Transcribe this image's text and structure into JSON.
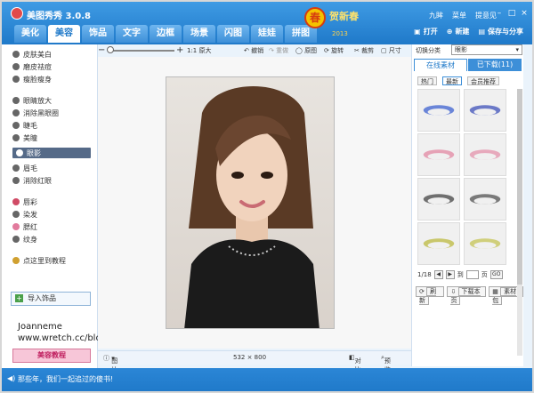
{
  "app": {
    "title": "美图秀秀 3.0.8"
  },
  "tabs": [
    "美化",
    "美容",
    "饰品",
    "文字",
    "边框",
    "场景",
    "闪图",
    "娃娃",
    "拼图"
  ],
  "header": {
    "new_year_text": "贺新春",
    "year": "2013",
    "badge": "春",
    "user": "九眸",
    "menu": "菜单",
    "feedback": "提意见",
    "actions": [
      "打开",
      "新建",
      "保存与分享"
    ]
  },
  "sidebar": {
    "items": [
      "皮肤美白",
      "磨皮祛痘",
      "瘦脸瘦身",
      "眼睛放大",
      "消除黑眼圈",
      "睫毛",
      "美瞳",
      "眼影",
      "眉毛",
      "消除红眼",
      "唇彩",
      "染发",
      "腮红",
      "纹身",
      "点这里到教程"
    ],
    "active_index": 7,
    "import_label": "导入饰品",
    "beauty_tutorial": "美容教程"
  },
  "watermark": {
    "name": "Joanneme",
    "url": "www.wretch.cc/blog/joanneme"
  },
  "toolbar": {
    "zoom_label": "1:1 原大",
    "undo": "撤销",
    "redo": "重做",
    "original": "原图",
    "rotate": "旋转",
    "crop": "裁剪",
    "size": "尺寸"
  },
  "status": {
    "image_info": "图片信息",
    "dimensions": "532 × 800",
    "compare": "对比",
    "preview": "预览"
  },
  "right_panel": {
    "switch_label": "切换分类",
    "category": "眼影",
    "tab_online": "在线素材",
    "tab_downloaded": "已下载(11)",
    "sub_tabs": [
      "热门",
      "最新",
      "会员推荐"
    ],
    "page": "1/18",
    "goto": "到",
    "page_unit": "页",
    "go": "GO",
    "refresh": "刷新",
    "download_page": "下载本页",
    "material_pack": "素材包"
  },
  "bottom": {
    "message": "那些年，我们一起追过的傻书!"
  },
  "colors": {
    "brand": "#1f79c9",
    "accent": "#3d8fd8",
    "active_side": "#556a88"
  }
}
